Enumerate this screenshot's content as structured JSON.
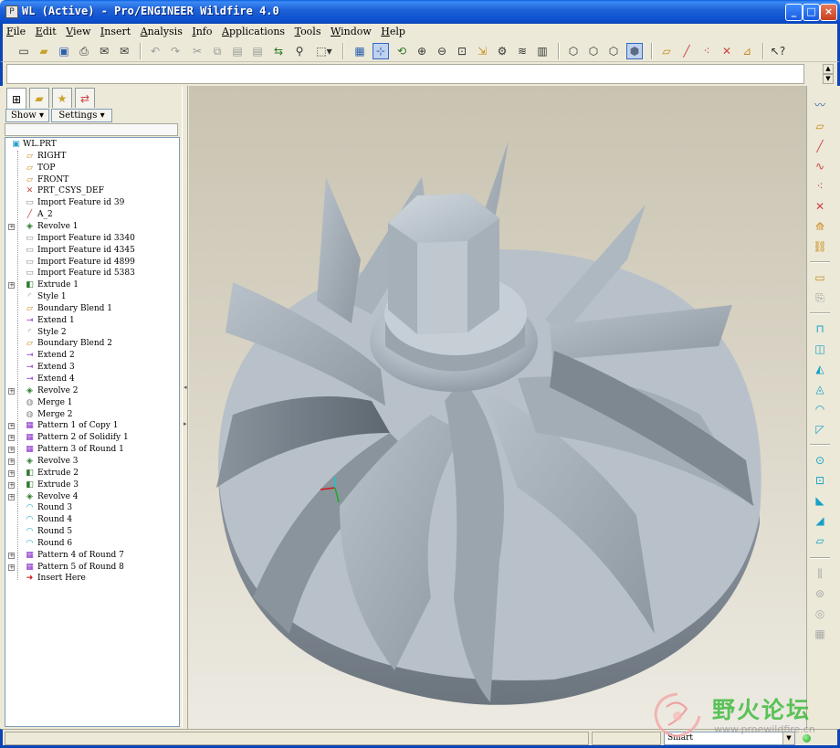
{
  "window": {
    "title": "WL (Active) - Pro/ENGINEER Wildfire 4.0",
    "buttons": {
      "minimize": "_",
      "maximize": "□",
      "close": "×"
    }
  },
  "menu": [
    "File",
    "Edit",
    "View",
    "Insert",
    "Analysis",
    "Info",
    "Applications",
    "Tools",
    "Window",
    "Help"
  ],
  "toolbar": {
    "icons": [
      "new-icon",
      "open-icon",
      "save-icon",
      "print-icon",
      "email-icon",
      "email-link-icon",
      "undo-icon",
      "redo-icon",
      "cut-icon",
      "copy-icon",
      "paste-icon",
      "paste-special-icon",
      "regenerate-icon",
      "find-icon",
      "select-box-icon",
      "repaint-icon",
      "spin-center-icon",
      "orient-mode-icon",
      "zoom-in-icon",
      "zoom-out-icon",
      "refit-icon",
      "reorient-icon",
      "saved-views-icon",
      "layers-icon",
      "view-manager-icon",
      "wireframe-icon",
      "hidden-line-icon",
      "no-hidden-icon",
      "shading-icon",
      "datum-planes-icon",
      "datum-axes-icon",
      "datum-points-icon",
      "csys-icon",
      "context-help-icon"
    ]
  },
  "navigator": {
    "show_label": "Show",
    "settings_label": "Settings",
    "tree": [
      {
        "label": "WL.PRT",
        "icon": "part-icon",
        "expandable": false,
        "root": true
      },
      {
        "label": "RIGHT",
        "icon": "datum-plane-icon",
        "expandable": false
      },
      {
        "label": "TOP",
        "icon": "datum-plane-icon",
        "expandable": false
      },
      {
        "label": "FRONT",
        "icon": "datum-plane-icon",
        "expandable": false
      },
      {
        "label": "PRT_CSYS_DEF",
        "icon": "csys-icon",
        "expandable": false
      },
      {
        "label": "Import Feature id 39",
        "icon": "import-icon",
        "expandable": false
      },
      {
        "label": "A_2",
        "icon": "datum-axis-icon",
        "expandable": false
      },
      {
        "label": "Revolve 1",
        "icon": "revolve-icon",
        "expandable": true
      },
      {
        "label": "Import Feature id 3340",
        "icon": "import-icon",
        "expandable": false
      },
      {
        "label": "Import Feature id 4345",
        "icon": "import-icon",
        "expandable": false
      },
      {
        "label": "Import Feature id 4899",
        "icon": "import-icon",
        "expandable": false
      },
      {
        "label": "Import Feature id 5383",
        "icon": "import-icon",
        "expandable": false
      },
      {
        "label": "Extrude 1",
        "icon": "extrude-icon",
        "expandable": true
      },
      {
        "label": "Style 1",
        "icon": "style-icon",
        "expandable": false
      },
      {
        "label": "Boundary Blend 1",
        "icon": "boundary-blend-icon",
        "expandable": false
      },
      {
        "label": "Extend 1",
        "icon": "extend-icon",
        "expandable": false
      },
      {
        "label": "Style 2",
        "icon": "style-icon",
        "expandable": false
      },
      {
        "label": "Boundary Blend 2",
        "icon": "boundary-blend-icon",
        "expandable": false
      },
      {
        "label": "Extend 2",
        "icon": "extend-icon",
        "expandable": false
      },
      {
        "label": "Extend 3",
        "icon": "extend-icon",
        "expandable": false
      },
      {
        "label": "Extend 4",
        "icon": "extend-icon",
        "expandable": false
      },
      {
        "label": "Revolve 2",
        "icon": "revolve-icon",
        "expandable": true
      },
      {
        "label": "Merge 1",
        "icon": "merge-icon",
        "expandable": false
      },
      {
        "label": "Merge 2",
        "icon": "merge-icon",
        "expandable": false
      },
      {
        "label": "Pattern 1 of Copy 1",
        "icon": "pattern-icon",
        "expandable": true
      },
      {
        "label": "Pattern 2 of Solidify 1",
        "icon": "pattern-icon",
        "expandable": true
      },
      {
        "label": "Pattern 3 of Round 1",
        "icon": "pattern-icon",
        "expandable": true
      },
      {
        "label": "Revolve 3",
        "icon": "revolve-icon",
        "expandable": true
      },
      {
        "label": "Extrude 2",
        "icon": "extrude-icon",
        "expandable": true
      },
      {
        "label": "Extrude 3",
        "icon": "extrude-icon",
        "expandable": true
      },
      {
        "label": "Revolve 4",
        "icon": "revolve-icon",
        "expandable": true
      },
      {
        "label": "Round 3",
        "icon": "round-icon",
        "expandable": false
      },
      {
        "label": "Round 4",
        "icon": "round-icon",
        "expandable": false
      },
      {
        "label": "Round 5",
        "icon": "round-icon",
        "expandable": false
      },
      {
        "label": "Round 6",
        "icon": "round-icon",
        "expandable": false
      },
      {
        "label": "Pattern 4 of Round 7",
        "icon": "pattern-icon",
        "expandable": true
      },
      {
        "label": "Pattern 5 of Round 8",
        "icon": "pattern-icon",
        "expandable": true
      },
      {
        "label": "Insert Here",
        "icon": "insert-arrow-icon",
        "expandable": false
      }
    ]
  },
  "status": {
    "filter": "Smart"
  },
  "watermark": {
    "text_cn": "野火论坛",
    "url": "www.proewildfire.cn"
  },
  "colors": {
    "model": "#9aa3ab",
    "accent": "#0b45b8"
  }
}
